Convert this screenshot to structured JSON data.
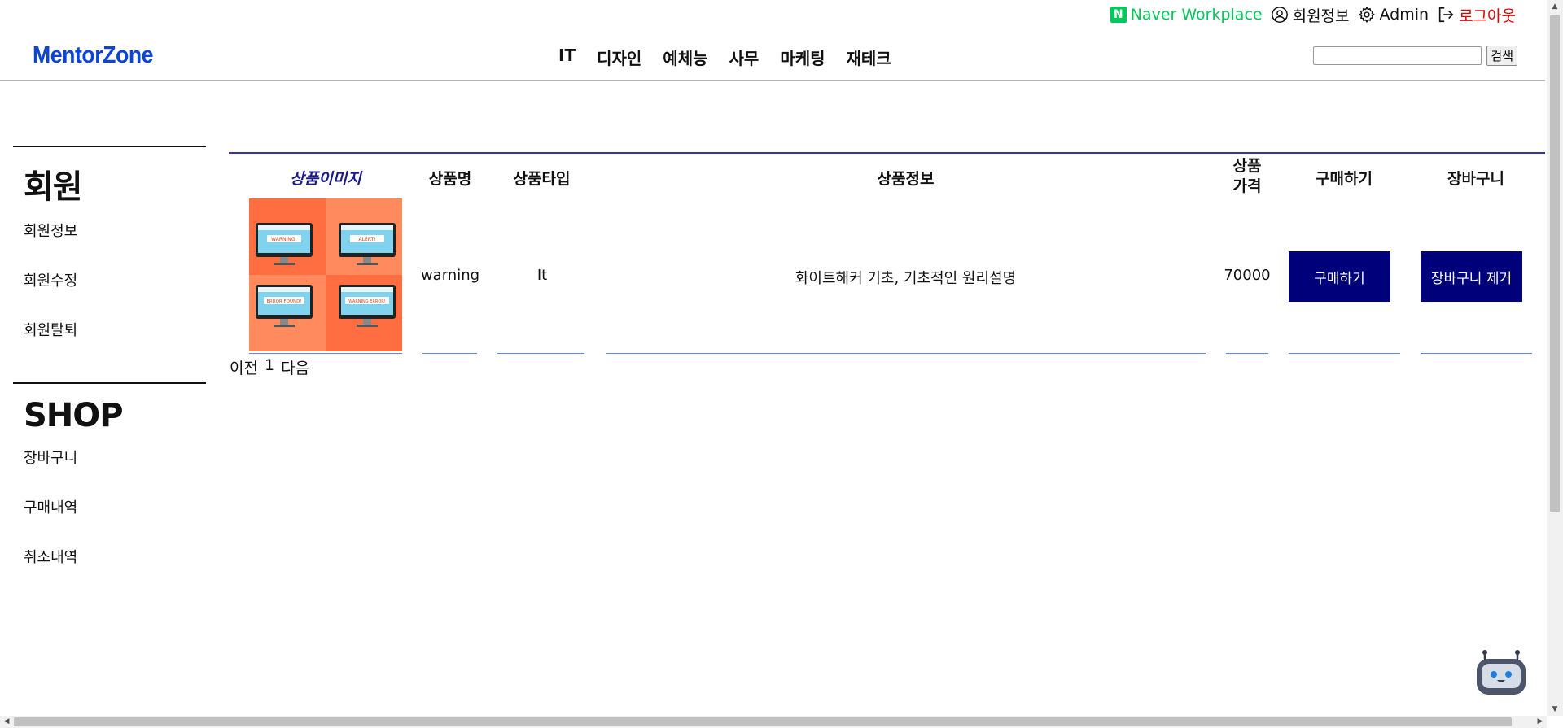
{
  "topbar": {
    "naver_badge": "N",
    "naver_label": "Naver Workplace",
    "member_info": "회원정보",
    "admin": "Admin",
    "logout": "로그아웃"
  },
  "header": {
    "logo": "MentorZone",
    "nav": [
      "IT",
      "디자인",
      "예체능",
      "사무",
      "마케팅",
      "재테크"
    ],
    "search_value": "",
    "search_button": "검색"
  },
  "sidebar": {
    "member_title": "회원",
    "member_links": [
      "회원정보",
      "회원수정",
      "회원탈퇴"
    ],
    "shop_title": "SHOP",
    "shop_links": [
      "장바구니",
      "구매내역",
      "취소내역"
    ]
  },
  "table": {
    "headers": {
      "image": "상품이미지",
      "name": "상품명",
      "type": "상품타입",
      "info": "상품정보",
      "price_line1": "상품",
      "price_line2": "가격",
      "buy": "구매하기",
      "cart": "장바구니"
    },
    "rows": [
      {
        "name": "warning",
        "type": "It",
        "info": "화이트해커 기초, 기초적인 원리설명",
        "price": "70000",
        "buy_button": "구매하기",
        "cart_button": "장바구니 제거",
        "image_labels": [
          "WARNING!",
          "ALERT!",
          "ERROR FOUND!",
          "WARNING ERROR!"
        ]
      }
    ]
  },
  "pager": {
    "prev": "이전",
    "page": "1",
    "next": "다음"
  },
  "colors": {
    "logo": "#0b45d8",
    "naver_green": "#03c75a",
    "logout_red": "#e00000",
    "button_navy": "#00007a",
    "table_line": "#3535a8"
  },
  "icons": [
    "naver-icon",
    "user-circle-icon",
    "gear-icon",
    "logout-icon",
    "chatbot-icon"
  ]
}
